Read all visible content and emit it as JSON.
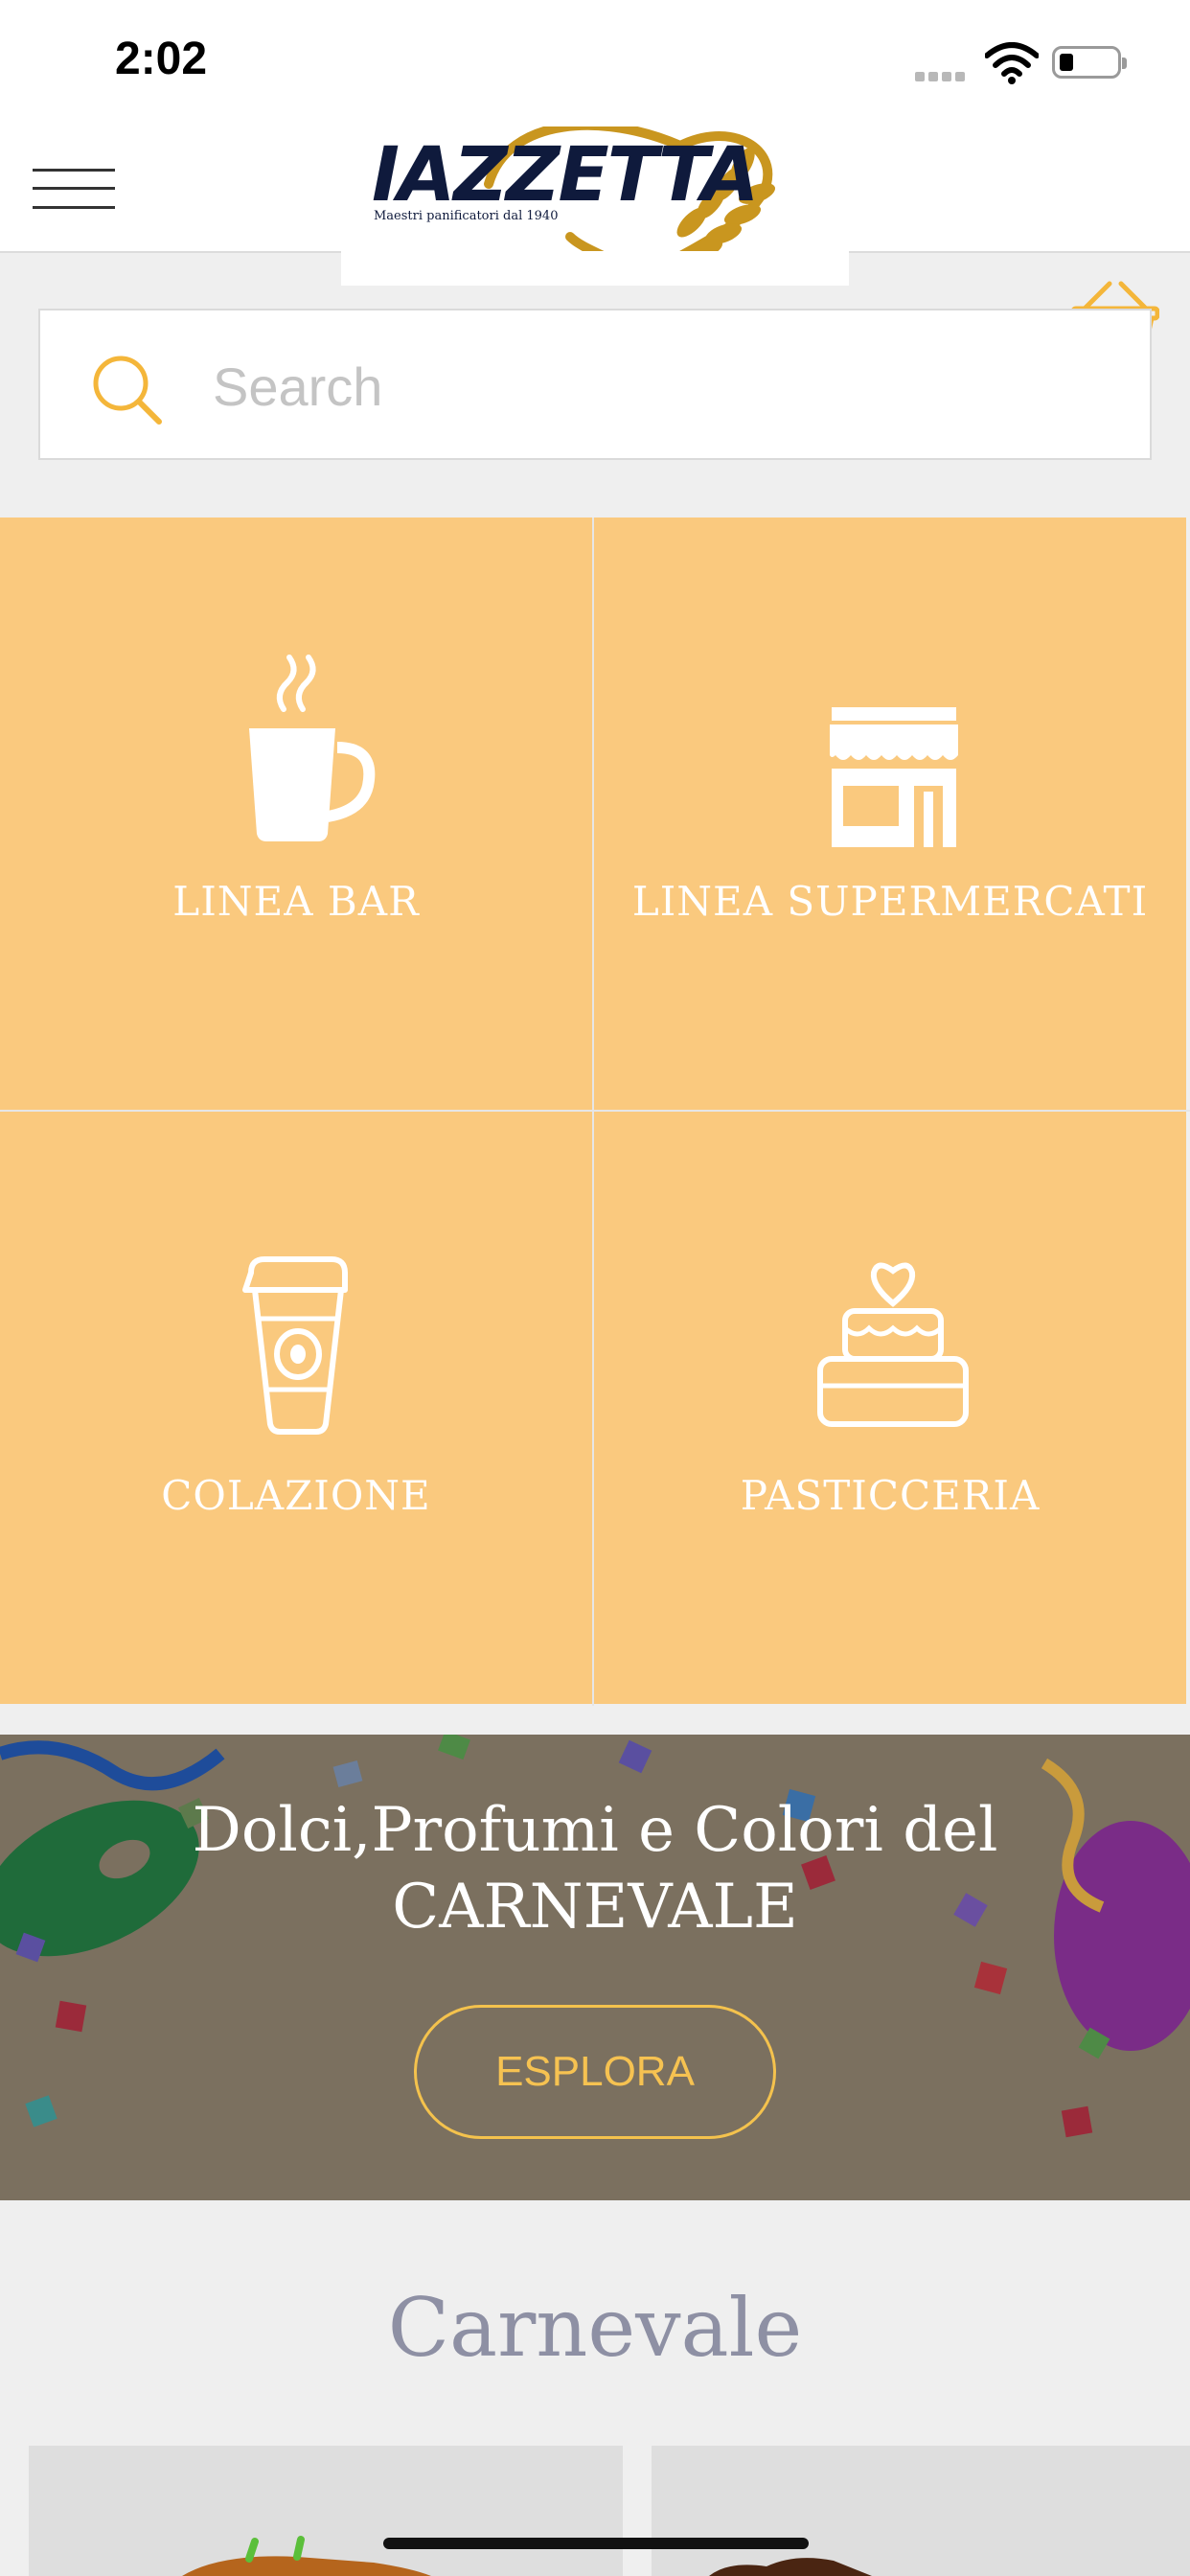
{
  "status_bar": {
    "time": "2:02"
  },
  "header": {
    "logo": {
      "name": "IAZZETTA",
      "tagline": "Maestri panificatori dal 1940"
    },
    "menu_icon": "hamburger-menu-icon",
    "cart_icon": "basket-icon"
  },
  "search": {
    "placeholder": "Search",
    "value": ""
  },
  "categories": [
    {
      "label": "LINEA BAR",
      "icon": "coffee-cup-icon"
    },
    {
      "label": "LINEA SUPERMERCATI",
      "icon": "storefront-icon"
    },
    {
      "label": "COLAZIONE",
      "icon": "takeaway-cup-icon"
    },
    {
      "label": "PASTICCERIA",
      "icon": "cake-icon"
    }
  ],
  "banner": {
    "title_line1": "Dolci,Profumi e Colori del",
    "title_line2": "CARNEVALE",
    "button_label": "ESPLORA"
  },
  "section": {
    "title": "Carnevale"
  },
  "colors": {
    "tile_bg": "#fac97e",
    "accent": "#f6c251",
    "logo_navy": "#0f1a3c",
    "logo_gold": "#c9961f",
    "section_title": "#8e90a4"
  }
}
